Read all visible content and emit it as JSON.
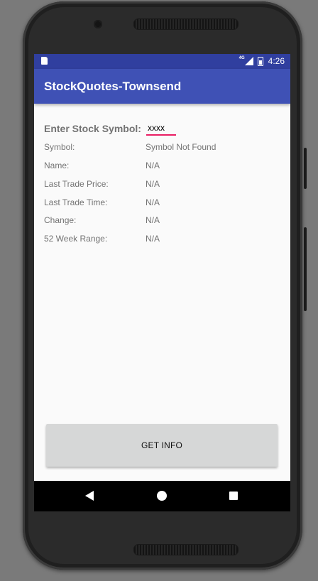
{
  "status_bar": {
    "network": "4G",
    "time": "4:26"
  },
  "app_bar": {
    "title": "StockQuotes-Townsend"
  },
  "form": {
    "enter_label": "Enter Stock Symbol:",
    "symbol_value": "xxxx",
    "accent_color": "#e91e63"
  },
  "quote": [
    {
      "label": "Symbol:",
      "value": "Symbol Not Found"
    },
    {
      "label": "Name:",
      "value": "N/A"
    },
    {
      "label": "Last Trade Price:",
      "value": "N/A"
    },
    {
      "label": "Last Trade Time:",
      "value": "N/A"
    },
    {
      "label": "Change:",
      "value": "N/A"
    },
    {
      "label": "52 Week Range:",
      "value": "N/A"
    }
  ],
  "button": {
    "label": "GET INFO"
  },
  "colors": {
    "primary": "#3f51b5",
    "primary_dark": "#303f9f"
  },
  "nav_icons": [
    "back-icon",
    "home-icon",
    "recents-icon"
  ]
}
